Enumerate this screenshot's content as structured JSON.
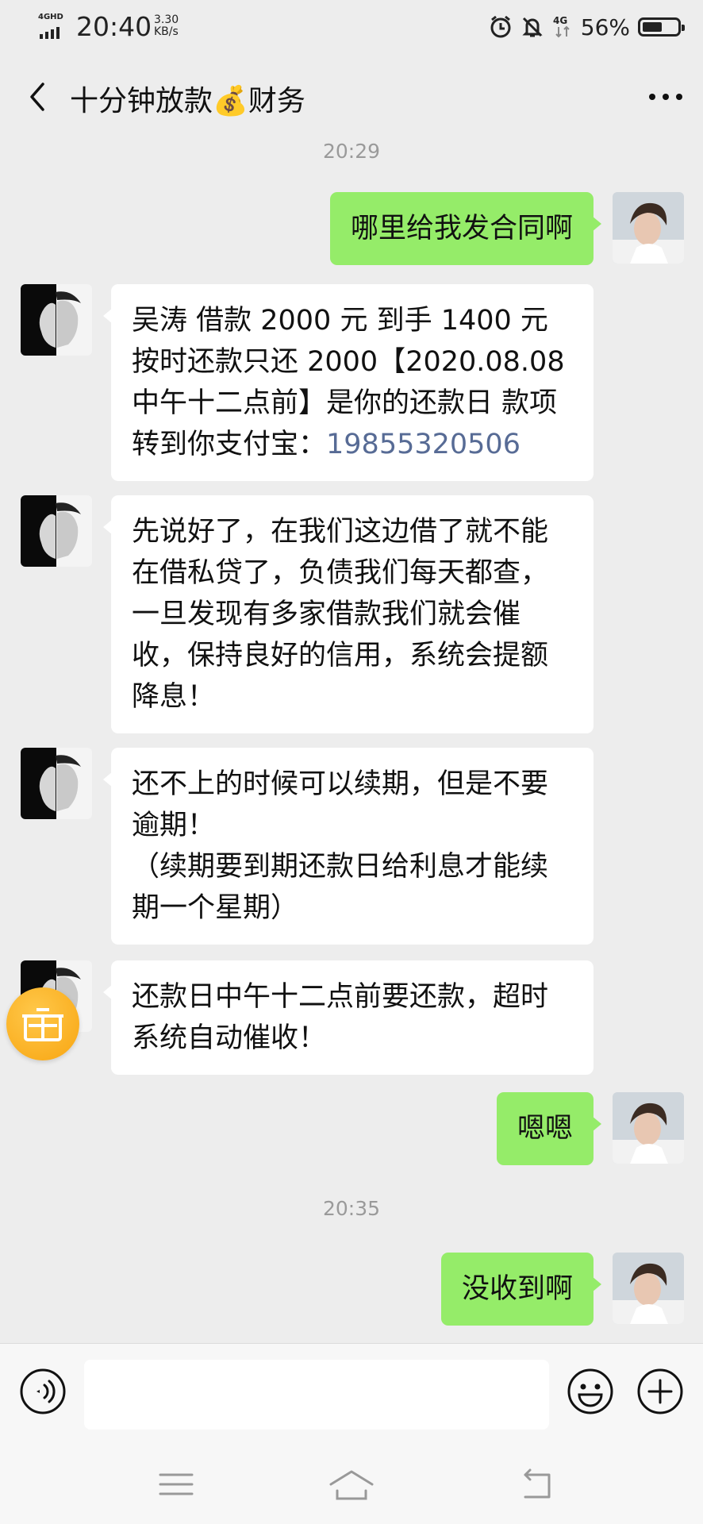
{
  "status_bar": {
    "network_label": "4GHD",
    "time": "20:40",
    "speed_value": "3.30",
    "speed_unit": "KB/s",
    "signal_label": "4G",
    "battery_text": "56%",
    "battery_level": 0.56
  },
  "header": {
    "title": "十分钟放款💰财务"
  },
  "messages": [
    {
      "type": "timestamp",
      "text": "20:29"
    },
    {
      "type": "sent",
      "text": "哪里给我发合同啊"
    },
    {
      "type": "received",
      "text": "吴涛 借款 2000 元 到手 1400 元 按时还款只还 2000【2020.08.08 中午十二点前】是你的还款日 款项转到你支付宝：",
      "link": "19855320506"
    },
    {
      "type": "received",
      "text": "先说好了，在我们这边借了就不能在借私贷了，负债我们每天都查，一旦发现有多家借款我们就会催收，保持良好的信用，系统会提额降息！"
    },
    {
      "type": "received",
      "text": "还不上的时候可以续期，但是不要逾期！\n（续期要到期还款日给利息才能续期一个星期）"
    },
    {
      "type": "received",
      "text": "还款日中午十二点前要还款，超时系统自动催收！"
    },
    {
      "type": "sent",
      "text": "嗯嗯"
    },
    {
      "type": "timestamp",
      "text": "20:35"
    },
    {
      "type": "sent",
      "text": "没收到啊"
    }
  ],
  "colors": {
    "background": "#ededed",
    "sent_bubble": "#95ec69",
    "received_bubble": "#ffffff",
    "link": "#576b95",
    "gift": "#f8a511"
  },
  "icons": [
    "back-icon",
    "more-icon",
    "gift-icon",
    "voice-icon",
    "emoji-icon",
    "plus-icon",
    "menu-icon",
    "home-icon",
    "return-icon",
    "alarm-icon",
    "mute-icon"
  ]
}
